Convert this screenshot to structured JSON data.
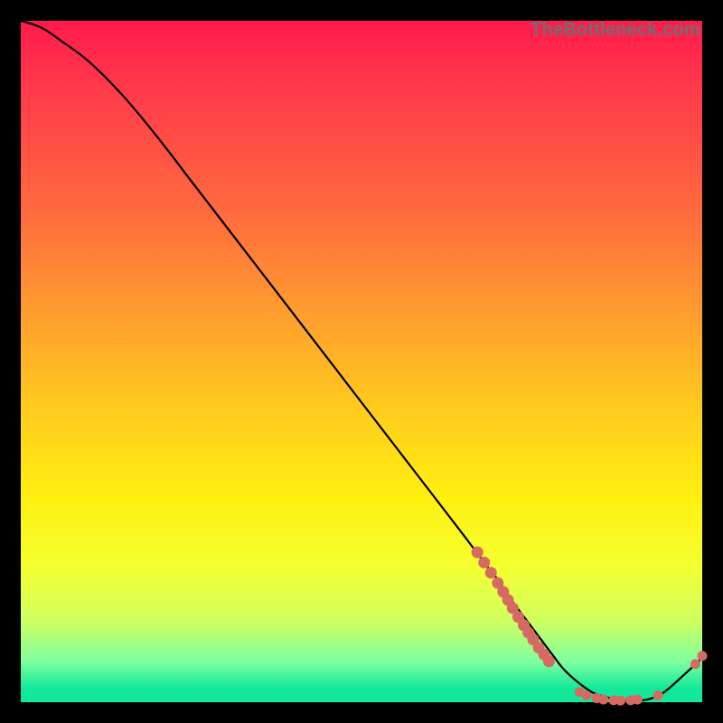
{
  "watermark": "TheBottleneck.com",
  "colors": {
    "background": "#000000",
    "gradient_top": "#ff1a4d",
    "gradient_bottom": "#12e89a",
    "curve": "#000000",
    "marker": "#d66a63"
  },
  "chart_data": {
    "type": "line",
    "title": "",
    "xlabel": "",
    "ylabel": "",
    "xlim": [
      0,
      100
    ],
    "ylim": [
      0,
      100
    ],
    "grid": false,
    "legend": false,
    "series": [
      {
        "name": "bottleneck-curve",
        "x": [
          0,
          3,
          6,
          10,
          15,
          20,
          25,
          30,
          35,
          40,
          45,
          50,
          55,
          60,
          65,
          68,
          70,
          72,
          75,
          78,
          80,
          83,
          85,
          88,
          90,
          92,
          94,
          96,
          100
        ],
        "y": [
          100,
          99,
          97,
          94,
          89,
          83,
          76.5,
          70,
          63.5,
          57,
          50.5,
          44,
          37.5,
          31,
          24.5,
          20.5,
          18,
          15,
          11,
          7,
          4.5,
          2,
          1,
          0.3,
          0.2,
          0.4,
          1.2,
          2.8,
          6.5
        ]
      }
    ],
    "markers": [
      {
        "name": "cluster-upper",
        "points": [
          {
            "x": 67,
            "y": 22
          },
          {
            "x": 68,
            "y": 20.5
          },
          {
            "x": 69,
            "y": 19
          },
          {
            "x": 70,
            "y": 17.5
          },
          {
            "x": 70.8,
            "y": 16.2
          },
          {
            "x": 71.5,
            "y": 15
          },
          {
            "x": 72.2,
            "y": 13.8
          },
          {
            "x": 73,
            "y": 12.5
          },
          {
            "x": 73.8,
            "y": 11.3
          },
          {
            "x": 74.5,
            "y": 10.2
          },
          {
            "x": 75.2,
            "y": 9.2
          },
          {
            "x": 76,
            "y": 8
          },
          {
            "x": 76.8,
            "y": 7
          },
          {
            "x": 77.5,
            "y": 6
          }
        ],
        "r": 6.5
      },
      {
        "name": "cluster-bottom",
        "points": [
          {
            "x": 82,
            "y": 1.5
          },
          {
            "x": 83,
            "y": 1.0
          },
          {
            "x": 84.5,
            "y": 0.6
          },
          {
            "x": 85.5,
            "y": 0.4
          },
          {
            "x": 87,
            "y": 0.3
          },
          {
            "x": 88,
            "y": 0.25
          },
          {
            "x": 89.5,
            "y": 0.3
          },
          {
            "x": 90.5,
            "y": 0.4
          },
          {
            "x": 93.5,
            "y": 1.0
          }
        ],
        "r": 5.5
      },
      {
        "name": "cluster-tail",
        "points": [
          {
            "x": 99,
            "y": 5.6
          },
          {
            "x": 100,
            "y": 6.8
          }
        ],
        "r": 5.5
      }
    ]
  }
}
